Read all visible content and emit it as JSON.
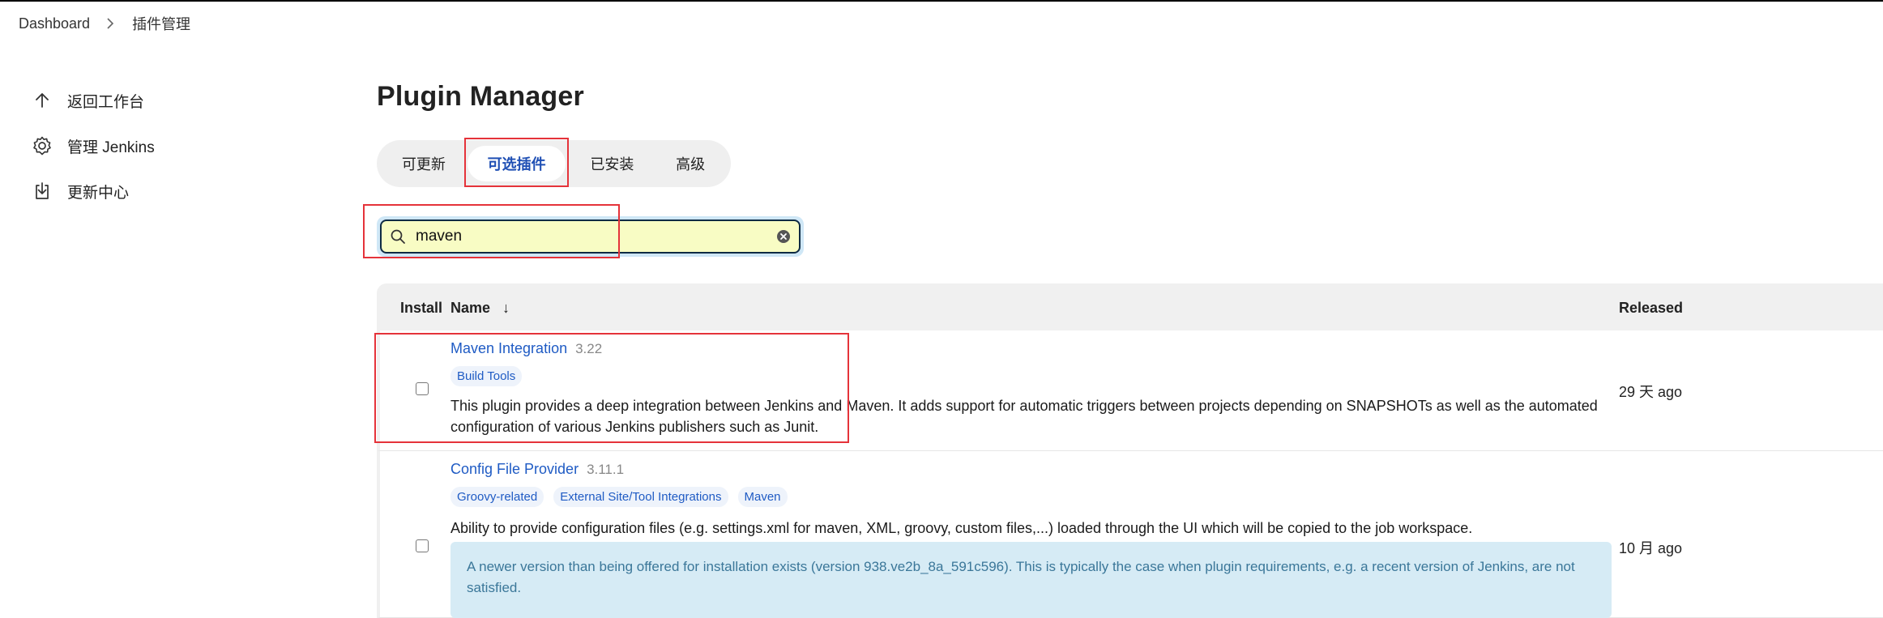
{
  "breadcrumb": {
    "home": "Dashboard",
    "current": "插件管理"
  },
  "sidebar": {
    "items": [
      {
        "label": "返回工作台",
        "icon": "arrow-up-icon"
      },
      {
        "label": "管理 Jenkins",
        "icon": "gear-icon"
      },
      {
        "label": "更新中心",
        "icon": "download-icon"
      }
    ]
  },
  "main": {
    "title": "Plugin Manager",
    "tabs": [
      {
        "label": "可更新"
      },
      {
        "label": "可选插件",
        "active": true
      },
      {
        "label": "已安装"
      },
      {
        "label": "高级"
      }
    ],
    "search": {
      "value": "maven",
      "placeholder": ""
    }
  },
  "table": {
    "headers": {
      "install": "Install",
      "name": "Name",
      "sort_indicator": "↓",
      "released": "Released"
    },
    "rows": [
      {
        "name": "Maven Integration",
        "version": "3.22",
        "tags": [
          "Build Tools"
        ],
        "description": "This plugin provides a deep integration between Jenkins and Maven. It adds support for automatic triggers between projects depending on SNAPSHOTs as well as the automated configuration of various Jenkins publishers such as Junit.",
        "released": "29 天 ago",
        "checked": false
      },
      {
        "name": "Config File Provider",
        "version": "3.11.1",
        "tags": [
          "Groovy-related",
          "External Site/Tool Integrations",
          "Maven"
        ],
        "description": "Ability to provide configuration files (e.g. settings.xml for maven, XML, groovy, custom files,...) loaded through the UI which will be copied to the job workspace.",
        "notice": "A newer version than being offered for installation exists (version 938.ve2b_8a_591c596). This is typically the case when plugin requirements, e.g. a recent version of Jenkins, are not satisfied.",
        "released": "10 月 ago",
        "checked": false
      }
    ]
  },
  "colors": {
    "accent": "#1f5bc4",
    "highlight_box": "#e5333a",
    "search_bg": "#f8fcc4",
    "notice_bg": "#d6ebf5"
  }
}
